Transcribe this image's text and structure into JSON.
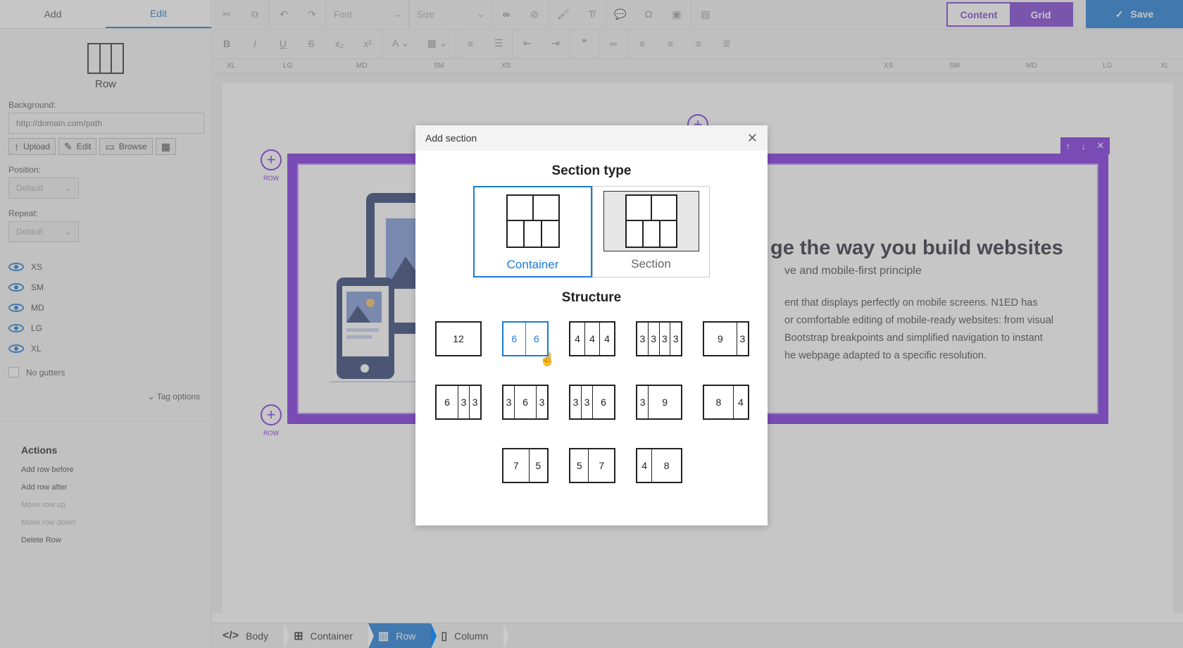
{
  "sidebar": {
    "tabs": [
      {
        "label": "Add"
      },
      {
        "label": "Edit"
      }
    ],
    "block_label": "Row",
    "background_label": "Background:",
    "url_placeholder": "http://domain.com/path",
    "buttons": {
      "upload": "Upload",
      "edit": "Edit",
      "browse": "Browse"
    },
    "position_label": "Position:",
    "position_value": "Default",
    "repeat_label": "Repeat:",
    "repeat_value": "Default",
    "breakpoints": [
      "XS",
      "SM",
      "MD",
      "LG",
      "XL"
    ],
    "no_gutters": "No gutters",
    "tag_options": "Tag options",
    "actions_title": "Actions",
    "actions": [
      {
        "label": "Add row before",
        "enabled": true
      },
      {
        "label": "Add row after",
        "enabled": true
      },
      {
        "label": "Move row up",
        "enabled": false
      },
      {
        "label": "Move row down",
        "enabled": false
      },
      {
        "label": "Delete Row",
        "enabled": true
      }
    ]
  },
  "toolbar": {
    "font_placeholder": "Font",
    "size_placeholder": "Size",
    "mode_content": "Content",
    "mode_grid": "Grid",
    "active_mode": "Grid",
    "save_label": "Save"
  },
  "ruler": {
    "labels": [
      "XL",
      "LG",
      "MD",
      "SM",
      "XS",
      "XS",
      "SM",
      "MD",
      "LG",
      "XL"
    ]
  },
  "canvas": {
    "row_label": "ROW",
    "hero_heading": "ge the way you build websites",
    "hero_subtitle": "ve and mobile-first principle",
    "hero_lines": [
      "ent that displays perfectly on mobile screens. N1ED has",
      "or comfortable editing of mobile-ready websites: from visual",
      "Bootstrap breakpoints and simplified navigation to instant",
      "he webpage adapted to a specific resolution."
    ]
  },
  "modal": {
    "title": "Add section",
    "section_type_title": "Section type",
    "types": [
      {
        "label": "Container",
        "selected": true
      },
      {
        "label": "Section",
        "selected": false
      }
    ],
    "structure_title": "Structure",
    "structures": [
      [
        "12"
      ],
      [
        "6",
        "6"
      ],
      [
        "4",
        "4",
        "4"
      ],
      [
        "3",
        "3",
        "3",
        "3"
      ],
      [
        "9",
        "3"
      ],
      [
        "6",
        "3",
        "3"
      ],
      [
        "3",
        "6",
        "3"
      ],
      [
        "3",
        "3",
        "6"
      ],
      [
        "3",
        "9"
      ],
      [
        "8",
        "4"
      ],
      [
        "7",
        "5"
      ],
      [
        "5",
        "7"
      ],
      [
        "4",
        "8"
      ]
    ],
    "hovered_structure": 1
  },
  "breadcrumbs": [
    {
      "label": "Body",
      "icon": "code-icon"
    },
    {
      "label": "Container",
      "icon": "container-icon"
    },
    {
      "label": "Row",
      "icon": "row-icon",
      "active": true
    },
    {
      "label": "Column",
      "icon": "column-icon"
    }
  ],
  "colors": {
    "accent": "#1a7bd6",
    "grid_purple": "#7a2be0"
  }
}
